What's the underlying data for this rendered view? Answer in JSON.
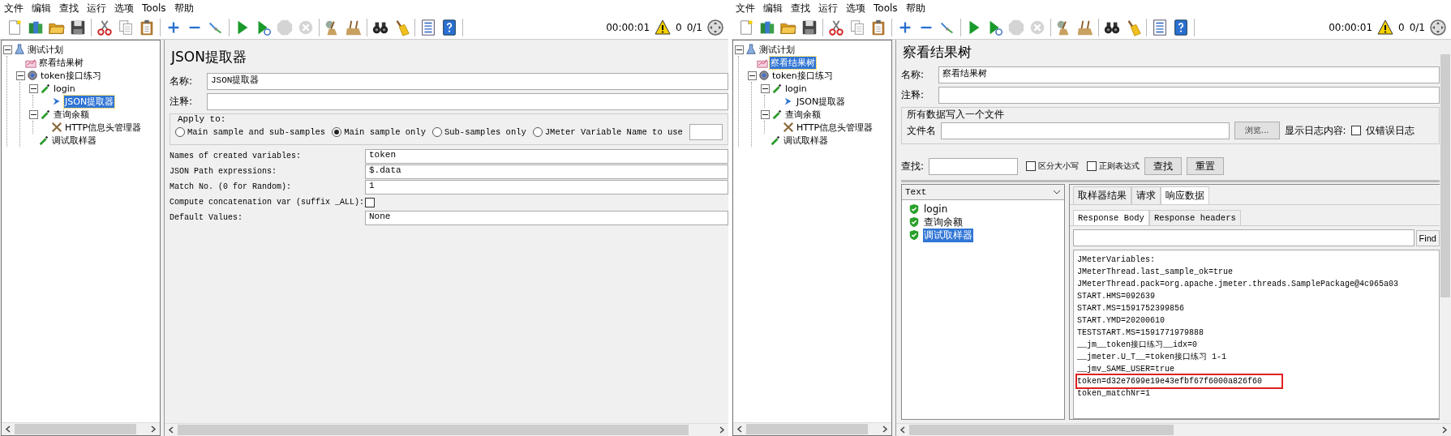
{
  "windows": [
    {
      "menu": [
        "文件",
        "编辑",
        "查找",
        "运行",
        "选项",
        "Tools",
        "帮助"
      ],
      "toolbar": {
        "groups": [
          [
            {
              "kind": "new",
              "disabled": false
            },
            {
              "kind": "templates",
              "disabled": false
            },
            {
              "kind": "open",
              "disabled": false
            },
            {
              "kind": "save",
              "disabled": false
            }
          ],
          [
            {
              "kind": "cut",
              "disabled": false
            },
            {
              "kind": "copy",
              "disabled": false
            },
            {
              "kind": "paste",
              "disabled": false
            }
          ],
          [
            {
              "kind": "expand",
              "disabled": false
            },
            {
              "kind": "collapse",
              "disabled": false
            },
            {
              "kind": "toggle",
              "disabled": false
            }
          ],
          [
            {
              "kind": "start",
              "disabled": false
            },
            {
              "kind": "start_no_pause",
              "disabled": false
            },
            {
              "kind": "stop",
              "disabled": true
            },
            {
              "kind": "shutdown",
              "disabled": true
            }
          ],
          [
            {
              "kind": "clear",
              "disabled": false
            },
            {
              "kind": "clear_all",
              "disabled": false
            }
          ],
          [
            {
              "kind": "search",
              "disabled": false
            },
            {
              "kind": "reset_search",
              "disabled": false
            }
          ],
          [
            {
              "kind": "function_helper",
              "disabled": false
            },
            {
              "kind": "help",
              "disabled": false
            }
          ]
        ],
        "timer": "00:00:01",
        "warnings": "0",
        "threads": "0/1"
      },
      "tree": [
        {
          "label": "测试计划",
          "kind": "plan",
          "selected": false,
          "expanded": true,
          "children": [
            {
              "label": "察看结果树",
              "kind": "listener",
              "selected": false
            },
            {
              "label": "token接口练习",
              "kind": "thread_group",
              "selected": false,
              "expanded": true,
              "children": [
                {
                  "label": "login",
                  "kind": "sampler",
                  "selected": false,
                  "expanded": true,
                  "children": [
                    {
                      "label": "JSON提取器",
                      "kind": "extractor",
                      "selected": true
                    }
                  ]
                },
                {
                  "label": "查询余额",
                  "kind": "sampler",
                  "selected": false,
                  "expanded": true,
                  "children": [
                    {
                      "label": "HTTP信息头管理器",
                      "kind": "config",
                      "selected": false
                    }
                  ]
                },
                {
                  "label": "调试取样器",
                  "kind": "sampler",
                  "selected": false
                }
              ]
            }
          ]
        }
      ],
      "panel": {
        "kind": "json_extractor",
        "title": "JSON提取器",
        "name_label": "名称:",
        "name": "JSON提取器",
        "comment_label": "注释:",
        "apply_to": {
          "legend": "Apply to:",
          "options": [
            {
              "label": "Main sample and sub-samples",
              "selected": false
            },
            {
              "label": "Main sample only",
              "selected": true
            },
            {
              "label": "Sub-samples only",
              "selected": false
            },
            {
              "label": "JMeter Variable Name to use",
              "selected": false
            }
          ]
        },
        "fields": [
          {
            "kind": "text",
            "label": "Names of created variables:",
            "value": "token"
          },
          {
            "kind": "text",
            "label": "JSON Path expressions:",
            "value": "$.data"
          },
          {
            "kind": "text",
            "label": "Match No. (0 for Random):",
            "value": "1"
          },
          {
            "kind": "checkbox",
            "label": "Compute concatenation var (suffix _ALL):",
            "checked": false
          },
          {
            "kind": "text",
            "label": "Default Values:",
            "value": "None"
          }
        ]
      }
    },
    {
      "menu": [
        "文件",
        "编辑",
        "查找",
        "运行",
        "选项",
        "Tools",
        "帮助"
      ],
      "toolbar": {
        "groups": [
          [
            {
              "kind": "new",
              "disabled": false
            },
            {
              "kind": "templates",
              "disabled": false
            },
            {
              "kind": "open",
              "disabled": false
            },
            {
              "kind": "save",
              "disabled": false
            }
          ],
          [
            {
              "kind": "cut",
              "disabled": false
            },
            {
              "kind": "copy",
              "disabled": false
            },
            {
              "kind": "paste",
              "disabled": false
            }
          ],
          [
            {
              "kind": "expand",
              "disabled": false
            },
            {
              "kind": "collapse",
              "disabled": false
            },
            {
              "kind": "toggle",
              "disabled": false
            }
          ],
          [
            {
              "kind": "start",
              "disabled": false
            },
            {
              "kind": "start_no_pause",
              "disabled": false
            },
            {
              "kind": "stop",
              "disabled": true
            },
            {
              "kind": "shutdown",
              "disabled": true
            }
          ],
          [
            {
              "kind": "clear",
              "disabled": false
            },
            {
              "kind": "clear_all",
              "disabled": false
            }
          ],
          [
            {
              "kind": "search",
              "disabled": false
            },
            {
              "kind": "reset_search",
              "disabled": false
            }
          ],
          [
            {
              "kind": "function_helper",
              "disabled": false
            },
            {
              "kind": "help",
              "disabled": false
            }
          ]
        ],
        "timer": "00:00:01",
        "warnings": "0",
        "threads": "0/1"
      },
      "tree": [
        {
          "label": "测试计划",
          "kind": "plan",
          "selected": false,
          "expanded": true,
          "children": [
            {
              "label": "察看结果树",
              "kind": "listener",
              "selected": true
            },
            {
              "label": "token接口练习",
              "kind": "thread_group",
              "selected": false,
              "expanded": true,
              "children": [
                {
                  "label": "login",
                  "kind": "sampler",
                  "selected": false,
                  "expanded": true,
                  "children": [
                    {
                      "label": "JSON提取器",
                      "kind": "extractor",
                      "selected": false
                    }
                  ]
                },
                {
                  "label": "查询余额",
                  "kind": "sampler",
                  "selected": false,
                  "expanded": true,
                  "children": [
                    {
                      "label": "HTTP信息头管理器",
                      "kind": "config",
                      "selected": false
                    }
                  ]
                },
                {
                  "label": "调试取样器",
                  "kind": "sampler",
                  "selected": false
                }
              ]
            }
          ]
        }
      ],
      "panel": {
        "kind": "results_tree",
        "title": "察看结果树",
        "name_label": "名称:",
        "name": "察看结果树",
        "comment_label": "注释:",
        "file_group": {
          "legend": "所有数据写入一个文件",
          "file_label": "文件名",
          "browse_button": "浏览...",
          "log_label": "显示日志内容:",
          "errors_only": {
            "label": "仅错误日志",
            "checked": false
          }
        },
        "search": {
          "label": "查找:",
          "options": [
            {
              "label": "区分大小写",
              "checked": false
            },
            {
              "label": "正则表达式",
              "checked": false
            }
          ],
          "buttons": [
            "查找",
            "重置"
          ]
        },
        "renderer": "Text",
        "results": [
          {
            "label": "login",
            "selected": false
          },
          {
            "label": "查询余额",
            "selected": false
          },
          {
            "label": "调试取样器",
            "selected": true
          }
        ],
        "tabs": [
          {
            "label": "取样器结果",
            "selected": false
          },
          {
            "label": "请求",
            "selected": false
          },
          {
            "label": "响应数据",
            "selected": true
          }
        ],
        "subtabs": [
          {
            "label": "Response Body",
            "selected": true
          },
          {
            "label": "Response headers",
            "selected": false
          }
        ],
        "find_button": "Find",
        "response_lines": [
          {
            "text": "JMeterVariables:",
            "highlighted": false
          },
          {
            "text": "JMeterThread.last_sample_ok=true",
            "highlighted": false
          },
          {
            "text": "JMeterThread.pack=org.apache.jmeter.threads.SamplePackage@4c965a03",
            "highlighted": false
          },
          {
            "text": "START.HMS=092639",
            "highlighted": false
          },
          {
            "text": "START.MS=1591752399856",
            "highlighted": false
          },
          {
            "text": "START.YMD=20200610",
            "highlighted": false
          },
          {
            "text": "TESTSTART.MS=1591771979888",
            "highlighted": false
          },
          {
            "text": "__jm__token接口练习__idx=0",
            "highlighted": false
          },
          {
            "text": "__jmeter.U_T__=token接口练习 1-1",
            "highlighted": false
          },
          {
            "text": "__jmv_SAME_USER=true",
            "highlighted": false
          },
          {
            "text": "token=d32e7699e19e43efbf67f6000a826f60",
            "highlighted": true
          },
          {
            "text": "token_matchNr=1",
            "highlighted": false
          }
        ]
      }
    }
  ]
}
